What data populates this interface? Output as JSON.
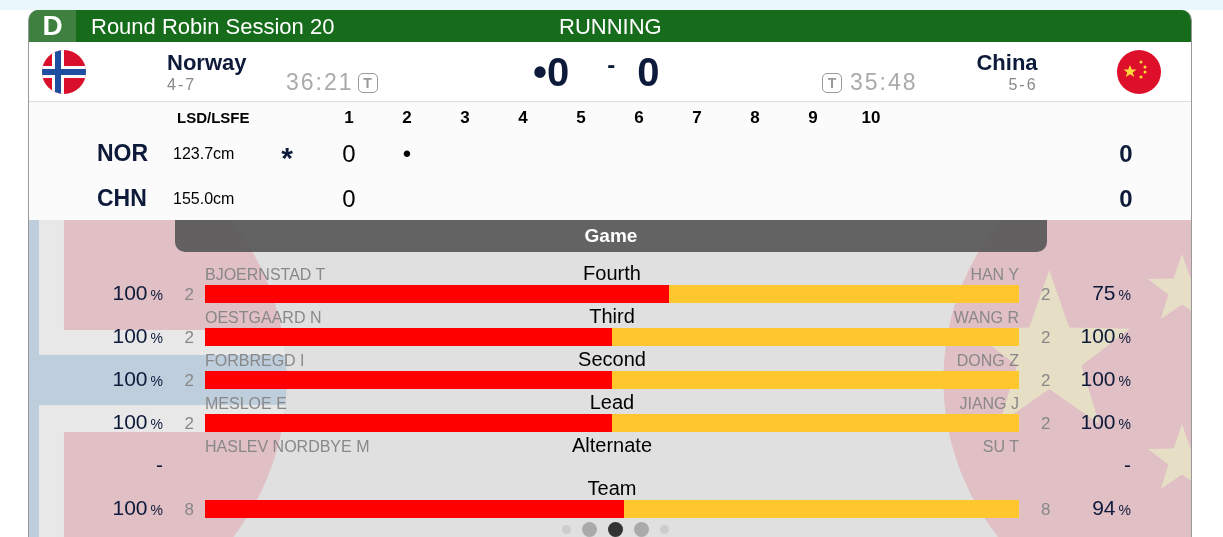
{
  "header": {
    "badge": "D",
    "title": "Round Robin Session 20",
    "status": "RUNNING"
  },
  "teams": [
    {
      "name": "Norway",
      "record": "4-7",
      "time": "36:21",
      "timeout_label": "T",
      "score": "•0",
      "kind": "norway"
    },
    {
      "name": "China",
      "record": "5-6",
      "time": "35:48",
      "timeout_label": "T",
      "score": "0",
      "kind": "china"
    }
  ],
  "score_separator": "-",
  "scoreboard": {
    "lsd_heading": "LSD/LSFE",
    "ends": [
      "1",
      "2",
      "3",
      "4",
      "5",
      "6",
      "7",
      "8",
      "9",
      "10"
    ],
    "rows": [
      {
        "code": "NOR",
        "lsd": "123.7cm",
        "hammer": "*",
        "ends": [
          "0",
          "•"
        ],
        "total": "0"
      },
      {
        "code": "CHN",
        "lsd": "155.0cm",
        "ends": [
          "0"
        ],
        "total": "0"
      }
    ]
  },
  "stats": {
    "title": "Game",
    "rows": [
      {
        "kind": "bar",
        "position": "Fourth",
        "left_name": "BJOERNSTAD T",
        "right_name": "HAN Y",
        "left_count": "2",
        "right_count": "2",
        "left_pct": "100",
        "right_pct": "75",
        "level": 0.57
      },
      {
        "kind": "bar",
        "position": "Third",
        "left_name": "OESTGAARD N",
        "right_name": "WANG R",
        "left_count": "2",
        "right_count": "2",
        "left_pct": "100",
        "right_pct": "100",
        "level": 0.5
      },
      {
        "kind": "bar",
        "position": "Second",
        "left_name": "FORBREGD I",
        "right_name": "DONG Z",
        "left_count": "2",
        "right_count": "2",
        "left_pct": "100",
        "right_pct": "100",
        "level": 0.5
      },
      {
        "kind": "bar",
        "position": "Lead",
        "left_name": "MESLOE E",
        "right_name": "JIANG J",
        "left_count": "2",
        "right_count": "2",
        "left_pct": "100",
        "right_pct": "100",
        "level": 0.5
      },
      {
        "kind": "empty",
        "position": "Alternate",
        "left_name": "HASLEV NORDBYE M",
        "right_name": "SU T",
        "left_pct": "-",
        "right_pct": "-"
      },
      {
        "kind": "bar",
        "position": "Team",
        "left_count": "8",
        "right_count": "8",
        "left_pct": "100",
        "right_pct": "94",
        "level": 0.515
      }
    ],
    "percent_sign": "%"
  },
  "pager": [
    {
      "kind": "small",
      "selected": false
    },
    {
      "kind": "large",
      "selected": false
    },
    {
      "kind": "large",
      "selected": true
    },
    {
      "kind": "large",
      "selected": false
    },
    {
      "kind": "small",
      "selected": false
    }
  ]
}
